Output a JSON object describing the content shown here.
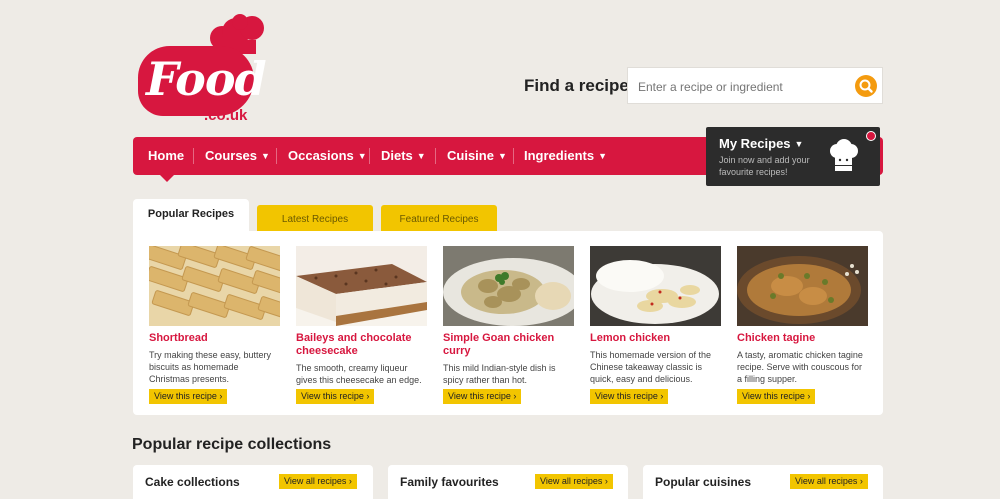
{
  "logo": {
    "text": "Food",
    "suffix": ".co.uk"
  },
  "search": {
    "label": "Find a recipe:",
    "placeholder": "Enter a recipe or ingredient"
  },
  "nav": {
    "items": [
      {
        "label": "Home"
      },
      {
        "label": "Courses"
      },
      {
        "label": "Occasions"
      },
      {
        "label": "Diets"
      },
      {
        "label": "Cuisine"
      },
      {
        "label": "Ingredients"
      }
    ]
  },
  "my_recipes": {
    "title": "My Recipes",
    "description": "Join now and add your favourite recipes!"
  },
  "tabs": [
    {
      "label": "Popular Recipes"
    },
    {
      "label": "Latest Recipes"
    },
    {
      "label": "Featured Recipes"
    }
  ],
  "recipes": [
    {
      "title": "Shortbread",
      "description": "Try making these easy, buttery biscuits as homemade Christmas presents.",
      "button": "View this recipe"
    },
    {
      "title": "Baileys and chocolate cheesecake",
      "description": "The smooth, creamy liqueur gives this cheesecake an edge.",
      "button": "View this recipe"
    },
    {
      "title": "Simple Goan chicken curry",
      "description": "This mild Indian-style dish is spicy rather than hot.",
      "button": "View this recipe"
    },
    {
      "title": "Lemon chicken",
      "description": "This homemade version of the Chinese takeaway classic is quick, easy and delicious.",
      "button": "View this recipe"
    },
    {
      "title": "Chicken tagine",
      "description": "A tasty, aromatic chicken tagine recipe. Serve with couscous for a filling supper.",
      "button": "View this recipe"
    }
  ],
  "collections": {
    "heading": "Popular recipe collections",
    "items": [
      {
        "title": "Cake collections",
        "button": "View all recipes"
      },
      {
        "title": "Family favourites",
        "button": "View all recipes"
      },
      {
        "title": "Popular cuisines",
        "button": "View all recipes"
      }
    ]
  },
  "colors": {
    "brand": "#d7173f",
    "accent": "#f2c500",
    "search_button": "#f49b0f",
    "dark_panel": "#2c2c2c"
  }
}
